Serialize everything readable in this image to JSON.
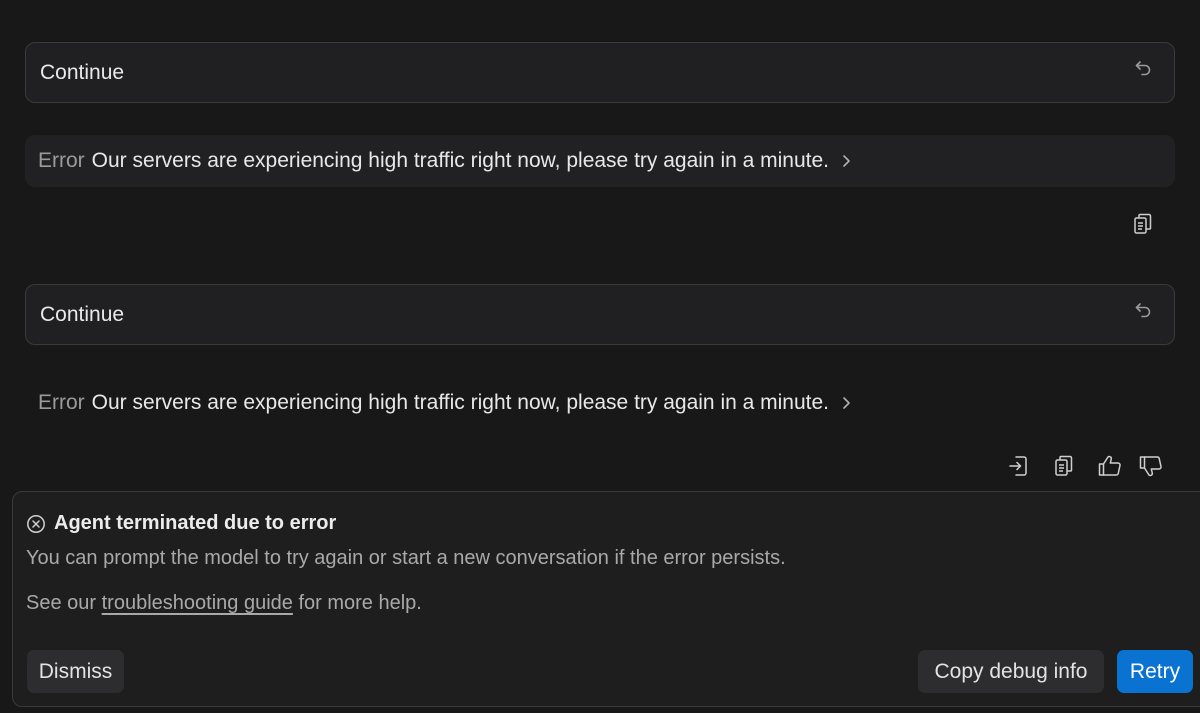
{
  "conversation": [
    {
      "user_message": "Continue",
      "undo_icon": "undo-icon",
      "error_label": "Error",
      "error_message": "Our servers are experiencing high traffic right now, please try again in a minute.",
      "expand_icon": "chevron-right-icon"
    },
    {
      "user_message": "Continue",
      "undo_icon": "undo-icon",
      "error_label": "Error",
      "error_message": "Our servers are experiencing high traffic right now, please try again in a minute.",
      "expand_icon": "chevron-right-icon"
    }
  ],
  "first_actions": [
    "copy-icon"
  ],
  "last_actions": [
    "export-icon",
    "copy-icon",
    "thumbs-up-icon",
    "thumbs-down-icon"
  ],
  "panel": {
    "icon": "x-circle-icon",
    "title": "Agent terminated due to error",
    "description": "You can prompt the model to try again or start a new conversation if the error persists.",
    "help_prefix": "See our",
    "help_link": "troubleshooting guide",
    "help_suffix": "for more help.",
    "dismiss_label": "Dismiss",
    "copy_label": "Copy debug info",
    "retry_label": "Retry"
  },
  "colors": {
    "background": "#181818",
    "accent": "#0a72d1"
  }
}
